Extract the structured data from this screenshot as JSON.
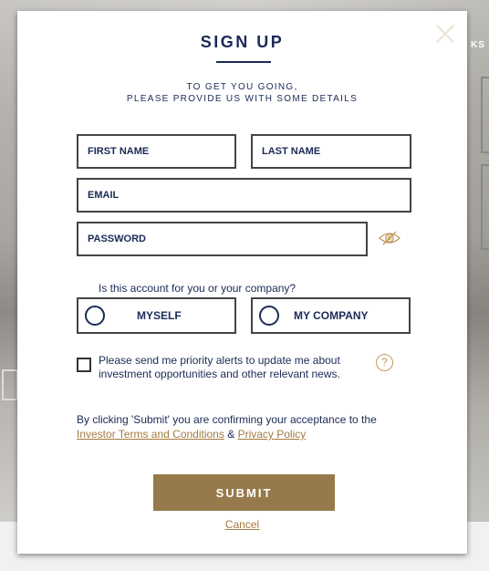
{
  "background": {
    "partial_nav_text": "KS"
  },
  "modal": {
    "title": "SIGN UP",
    "subtitle_line1": "TO GET YOU GOING,",
    "subtitle_line2": "PLEASE PROVIDE US WITH SOME DETAILS",
    "fields": {
      "first_name": {
        "placeholder": "FIRST NAME",
        "value": ""
      },
      "last_name": {
        "placeholder": "LAST NAME",
        "value": ""
      },
      "email": {
        "placeholder": "EMAIL",
        "value": ""
      },
      "password": {
        "placeholder": "PASSWORD",
        "value": ""
      }
    },
    "password_toggle_icon": "eye-slash-icon",
    "account_question": "Is this account for you or your company?",
    "account_options": [
      {
        "label": "MYSELF",
        "selected": false
      },
      {
        "label": "MY COMPANY",
        "selected": false
      }
    ],
    "alerts_checkbox": {
      "checked": false,
      "label": "Please send me priority alerts to update me about investment opportunities and other relevant news."
    },
    "help_icon": "?",
    "terms": {
      "prefix": "By clicking 'Submit' you are confirming your acceptance to the",
      "terms_link": "Investor Terms and Conditions",
      "separator": "&",
      "privacy_link": "Privacy Policy"
    },
    "submit_label": "SUBMIT",
    "cancel_label": "Cancel"
  },
  "colors": {
    "navy": "#1b2a56",
    "gold": "#977a4b",
    "link_gold": "#a37b3e",
    "border": "#444444"
  }
}
